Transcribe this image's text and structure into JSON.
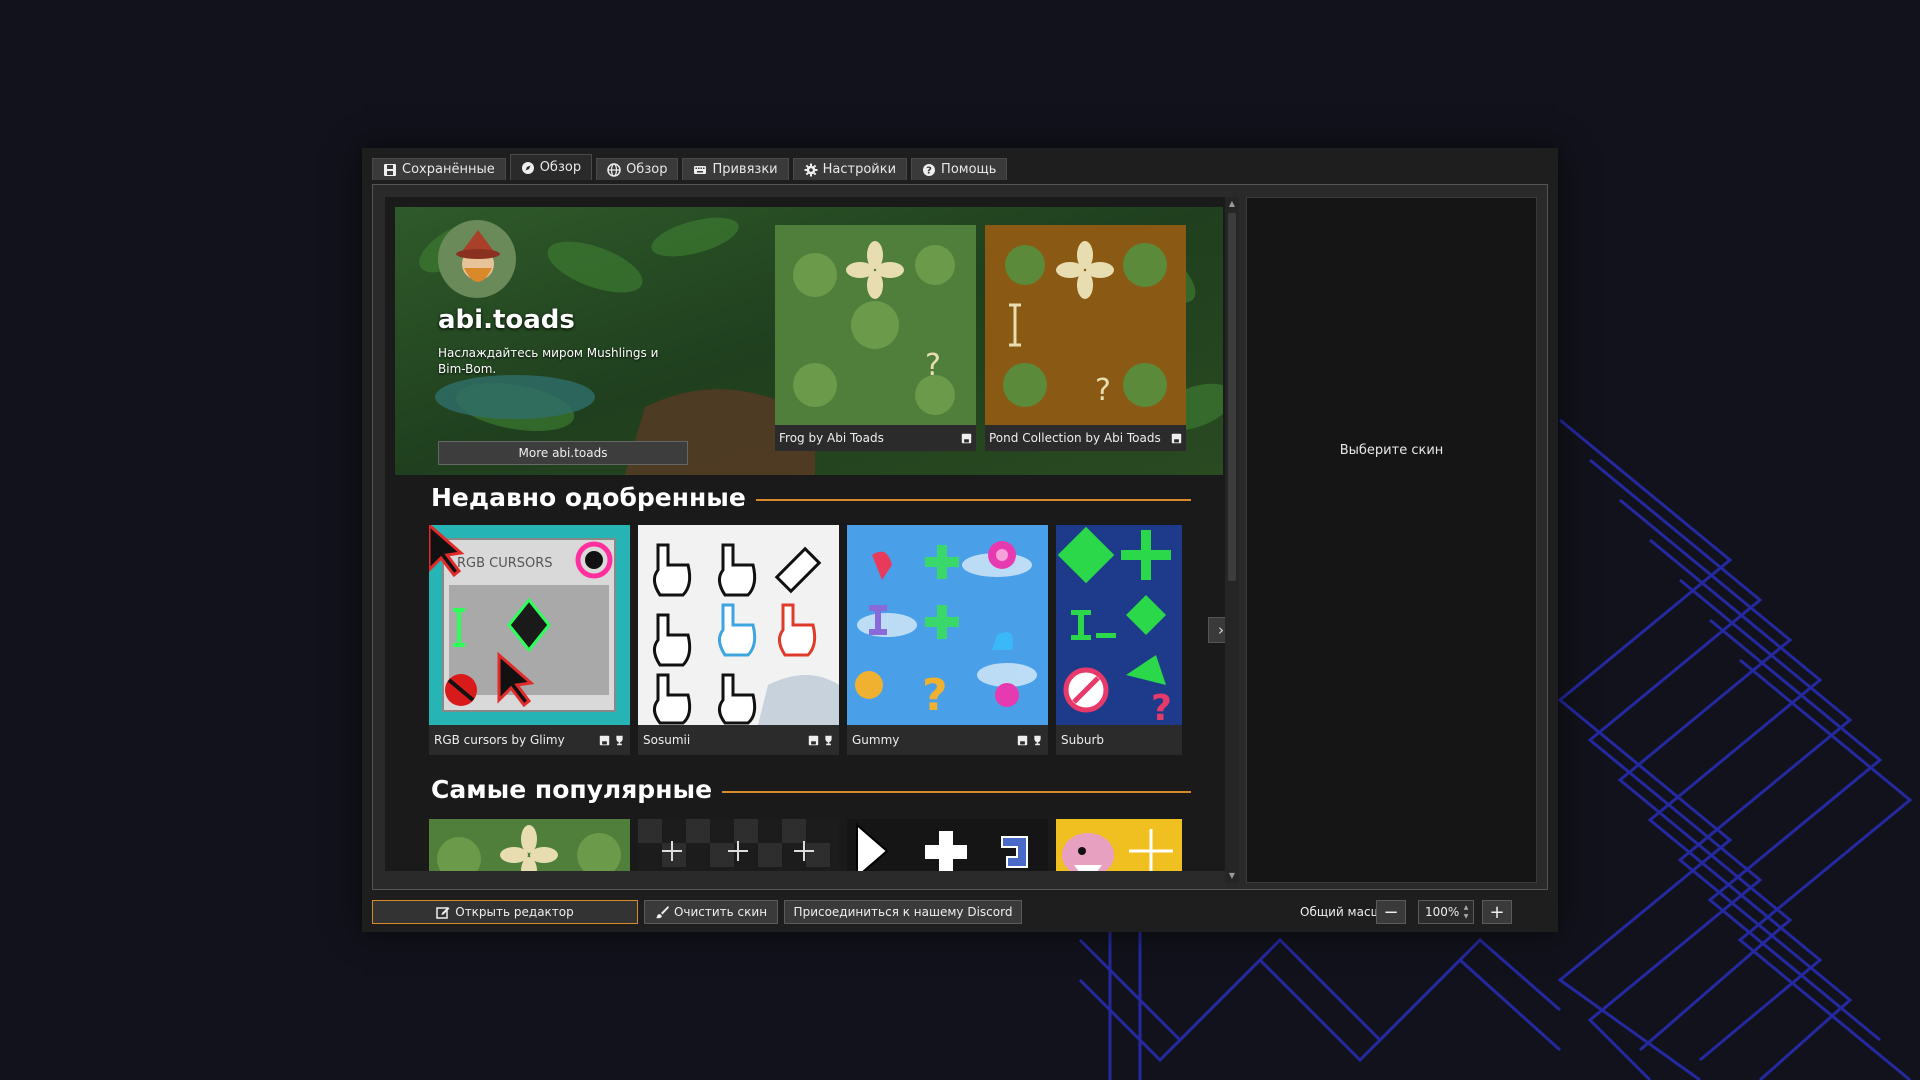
{
  "tabs": [
    {
      "label": "Сохранённые",
      "icon": "save-icon"
    },
    {
      "label": "Обзор",
      "icon": "compass-icon",
      "active": true
    },
    {
      "label": "Обзор",
      "icon": "globe-icon"
    },
    {
      "label": "Привязки",
      "icon": "keyboard-icon"
    },
    {
      "label": "Настройки",
      "icon": "gear-icon"
    },
    {
      "label": "Помощь",
      "icon": "help-icon"
    }
  ],
  "featured": {
    "creator": "abi.toads",
    "description": "Наслаждайтесь миром Mushlings и Bim-Bom.",
    "more_button": "More abi.toads",
    "items": [
      {
        "title": "Frog by Abi Toads",
        "icon": "save-icon"
      },
      {
        "title": "Pond Collection by Abi Toads",
        "icon": "save-icon"
      }
    ]
  },
  "sections": {
    "recent_title": "Недавно одобренные",
    "popular_title": "Самые популярные"
  },
  "recent": [
    {
      "title": "RGB cursors by Glimy",
      "icons": [
        "save-icon",
        "trophy-icon"
      ],
      "image_text": "RGB CURSORS"
    },
    {
      "title": "Sosumii",
      "icons": [
        "save-icon",
        "trophy-icon"
      ]
    },
    {
      "title": "Gummy",
      "icons": [
        "save-icon",
        "trophy-icon"
      ]
    },
    {
      "title": "Suburb",
      "icons": []
    }
  ],
  "right_panel": {
    "placeholder": "Выберите скин"
  },
  "bottom": {
    "open_editor": "Открыть редактор",
    "clear_skin": "Очистить скин",
    "discord": "Присоединиться к нашему Discord",
    "scale_label": "Общий масштаб:",
    "zoom_value": "100%"
  },
  "colors": {
    "accent": "#d9882a",
    "background": "#12121c",
    "window": "#1e1e1e"
  }
}
